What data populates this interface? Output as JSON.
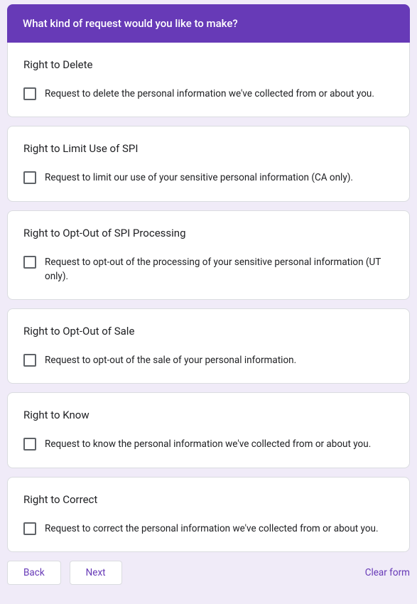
{
  "header": {
    "title": "What kind of request would you like to make?"
  },
  "questions": [
    {
      "title": "Right to Delete",
      "option": "Request to delete the personal information we've collected from or about you."
    },
    {
      "title": "Right to Limit Use of SPI",
      "option": "Request to limit our use of your sensitive personal information (CA only)."
    },
    {
      "title": "Right to Opt-Out of SPI Processing",
      "option": "Request to opt-out of the processing of your sensitive personal information (UT only)."
    },
    {
      "title": "Right to Opt-Out of Sale",
      "option": "Request to opt-out of the sale of your personal information."
    },
    {
      "title": "Right to Know",
      "option": "Request to know the personal information we've collected from or about you."
    },
    {
      "title": "Right to Correct",
      "option": "Request to correct the personal information we've collected from or about you."
    }
  ],
  "footer": {
    "back": "Back",
    "next": "Next",
    "clear": "Clear form"
  }
}
